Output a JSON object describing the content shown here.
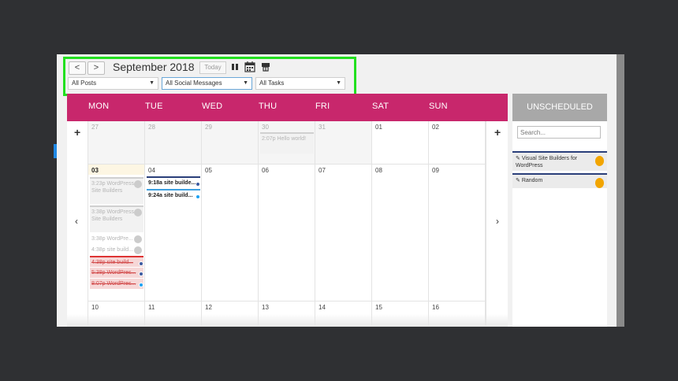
{
  "toolbar": {
    "prev_label": "<",
    "next_label": ">",
    "month_title": "September 2018",
    "today_label": "Today",
    "filters": [
      {
        "value": "All Posts"
      },
      {
        "value": "All Social Messages"
      },
      {
        "value": "All Tasks"
      }
    ],
    "icons": [
      "pause-icon",
      "calendar-icon",
      "print-icon"
    ]
  },
  "calendar": {
    "day_names": [
      "MON",
      "TUE",
      "WED",
      "THU",
      "FRI",
      "SAT",
      "SUN"
    ],
    "add_label": "+",
    "nav_prev": "‹",
    "nav_next": "›",
    "weeks": [
      [
        "27",
        "28",
        "29",
        "30",
        "31",
        "01",
        "02"
      ],
      [
        "03",
        "04",
        "05",
        "06",
        "07",
        "08",
        "09"
      ],
      [
        "10",
        "11",
        "12",
        "13",
        "14",
        "15",
        "16"
      ]
    ],
    "events": {
      "thu30": "2:07p Hello world!",
      "mon03": [
        "3:23p WordPress Site Builders",
        "3:38p WordPress Site Builders",
        "3:38p WordPre...",
        "4:38p site build...",
        "4:38p site build...",
        "5:38p WordPres...",
        "8:07p WordPres..."
      ],
      "tue04": [
        "9:18a site builde...",
        "9:24a site build..."
      ]
    }
  },
  "unscheduled": {
    "title": "UNSCHEDULED",
    "search_placeholder": "Search...",
    "items": [
      {
        "label": "Visual Site Builders for WordPress"
      },
      {
        "label": "Random"
      }
    ]
  },
  "colors": {
    "header": "#c8276c",
    "highlight": "#22e01f",
    "unscheduled_header": "#a8a8a8"
  }
}
